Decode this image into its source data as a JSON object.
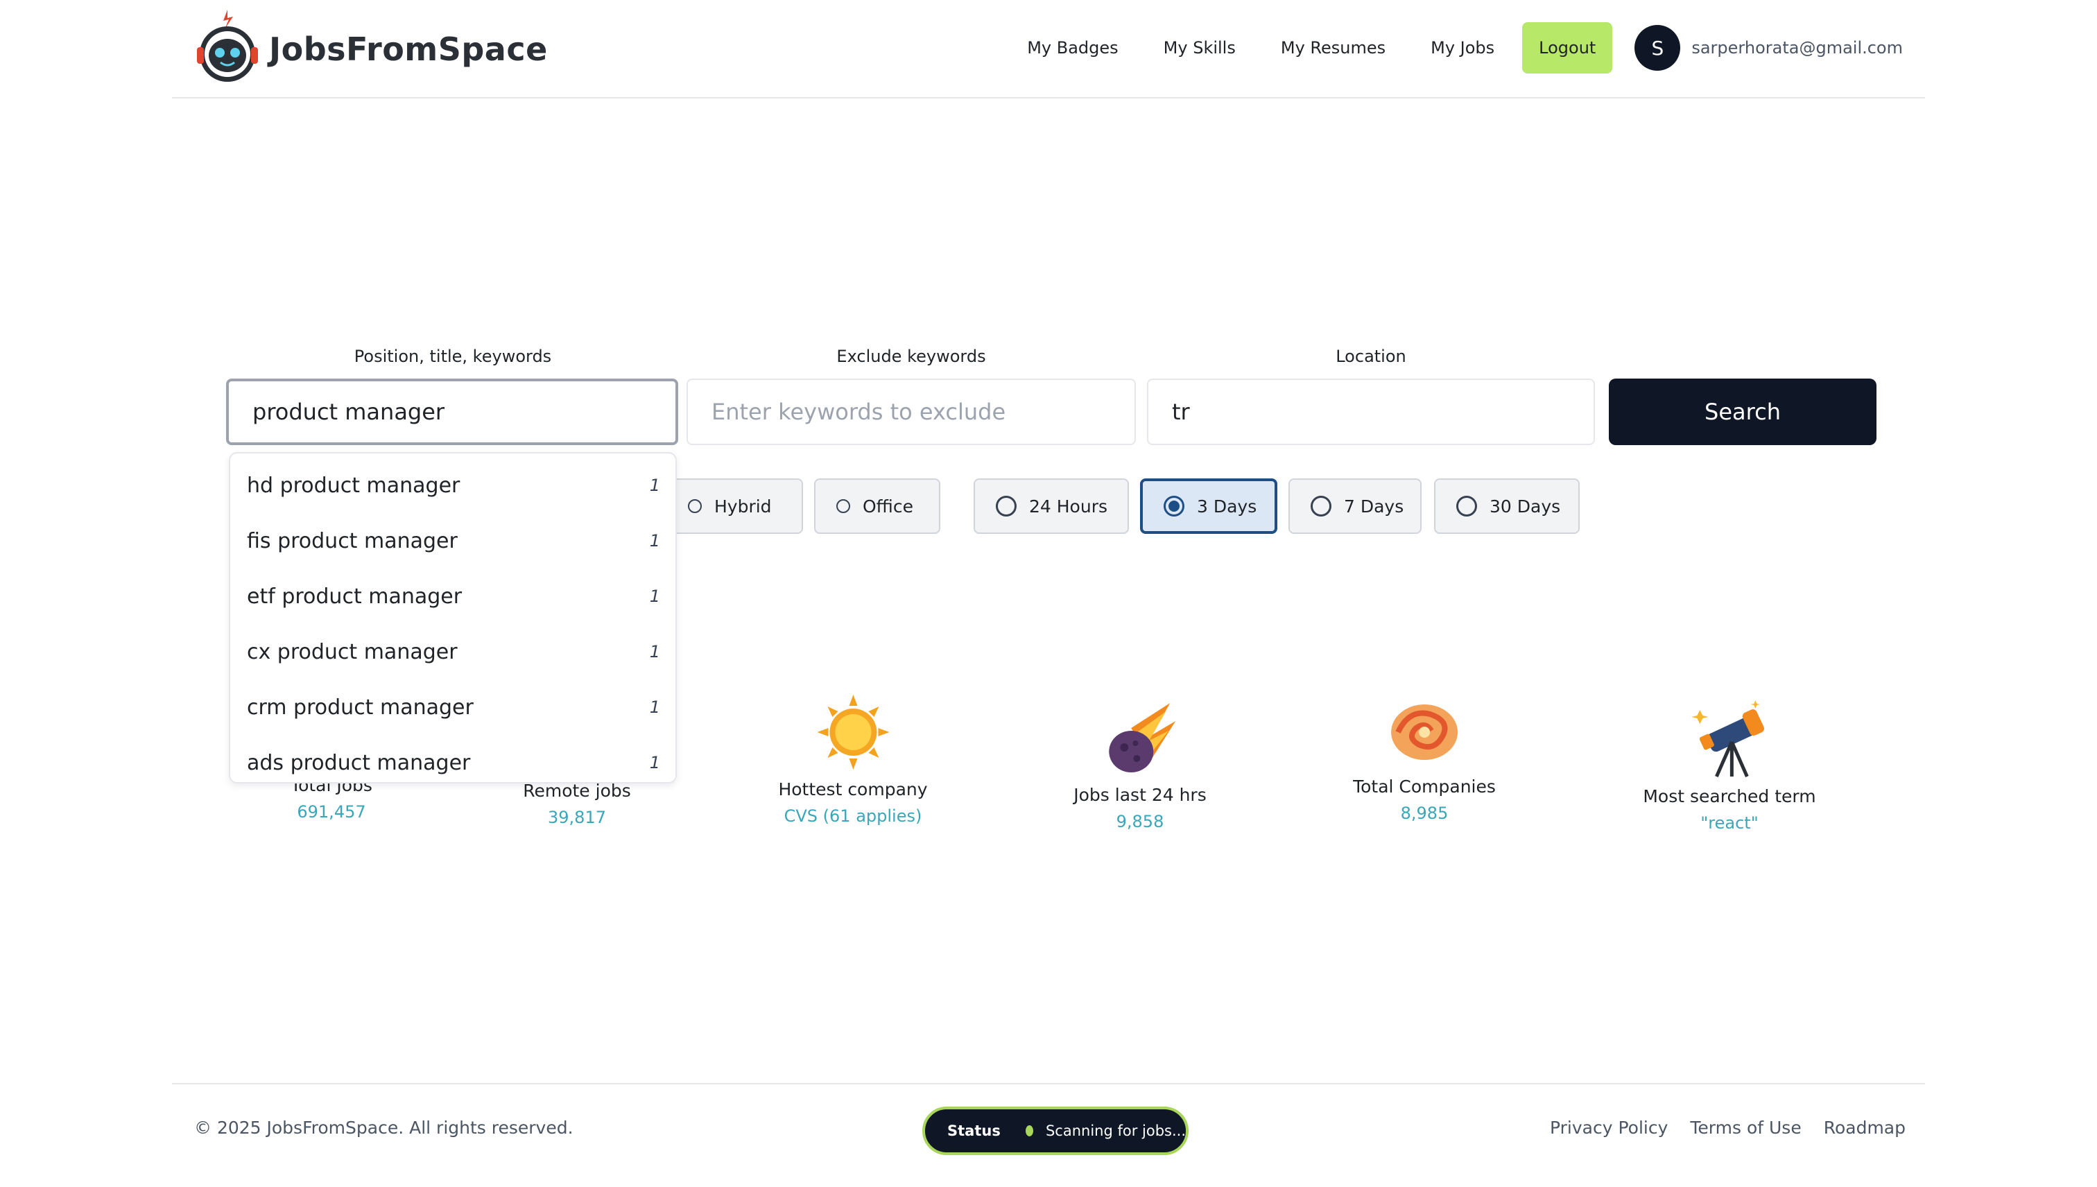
{
  "brand": {
    "name": "JobsFromSpace",
    "icon": "robot-astronaut-logo"
  },
  "nav": {
    "items": [
      "My Badges",
      "My Skills",
      "My Resumes",
      "My Jobs"
    ],
    "logout_label": "Logout",
    "avatar_initial": "S",
    "user_email": "sarperhorata@gmail.com"
  },
  "colors": {
    "accent": "#b7e868",
    "primary": "#0f1626",
    "stat_value": "#3aa6b9",
    "selected_chip": "#1e4e86"
  },
  "search": {
    "position_label": "Position, title, keywords",
    "position_value": "product manager",
    "exclude_label": "Exclude keywords",
    "exclude_placeholder": "Enter keywords to exclude",
    "location_label": "Location",
    "location_value": "tr",
    "button_label": "Search"
  },
  "work_type": {
    "options": [
      "Hybrid",
      "Office"
    ]
  },
  "time_filter": {
    "options": [
      "24 Hours",
      "3 Days",
      "7 Days",
      "30 Days"
    ],
    "selected": "3 Days"
  },
  "suggestions": [
    {
      "text": "hd product manager",
      "count": "1"
    },
    {
      "text": "fis product manager",
      "count": "1"
    },
    {
      "text": "etf product manager",
      "count": "1"
    },
    {
      "text": "cx product manager",
      "count": "1"
    },
    {
      "text": "crm product manager",
      "count": "1"
    },
    {
      "text": "ads product manager",
      "count": "1"
    }
  ],
  "stats": [
    {
      "label": "Total Jobs",
      "value": "691,457"
    },
    {
      "label": "Remote jobs",
      "value": "39,817"
    },
    {
      "label": "Hottest company",
      "value": "CVS (61 applies)",
      "icon": "sun-icon"
    },
    {
      "label": "Jobs last 24 hrs",
      "value": "9,858",
      "icon": "meteor-icon"
    },
    {
      "label": "Total Companies",
      "value": "8,985",
      "icon": "galaxy-icon"
    },
    {
      "label": "Most searched term",
      "value": "\"react\"",
      "icon": "telescope-icon"
    }
  ],
  "footer": {
    "copyright": "© 2025 JobsFromSpace. All rights reserved.",
    "status_label": "Status",
    "status_text": "Scanning for jobs...",
    "links": [
      "Privacy Policy",
      "Terms of Use",
      "Roadmap"
    ]
  }
}
